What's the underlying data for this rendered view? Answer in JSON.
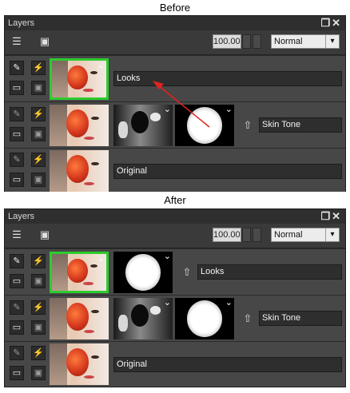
{
  "captions": {
    "before": "Before",
    "after": "After"
  },
  "panel": {
    "title": "Layers",
    "opacity_value": "100.00",
    "blend_mode": "Normal",
    "icons": {
      "layer_options": "layers-settings-icon",
      "mask": "mask-icon",
      "restore": "restore-window-icon",
      "close": "close-icon"
    }
  },
  "before": {
    "layers": [
      {
        "name": "Looks",
        "selected": true
      },
      {
        "name": "Skin Tone",
        "selected": false
      },
      {
        "name": "Original",
        "selected": false
      }
    ]
  },
  "after": {
    "layers": [
      {
        "name": "Looks",
        "selected": true
      },
      {
        "name": "Skin Tone",
        "selected": false
      },
      {
        "name": "Original",
        "selected": false
      }
    ]
  },
  "colors": {
    "selection": "#2dcc2d",
    "annotation_arrow": "#e32222",
    "panel_bg": "#3b3b3b"
  }
}
